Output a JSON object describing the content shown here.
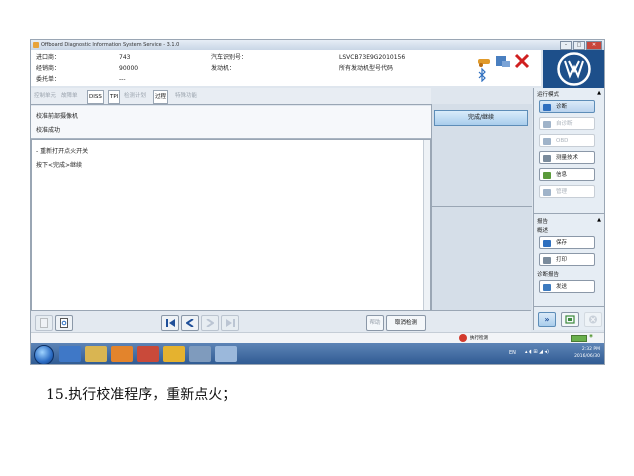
{
  "window": {
    "title": "Offboard Diagnostic Information System Service - 3.1.0"
  },
  "info": {
    "import_label": "进口商：",
    "import_value": "743",
    "dealer_label": "经销商：",
    "dealer_value": "90000",
    "client_label": "委托单：",
    "client_value": "---",
    "vin_label": "汽车识别号：",
    "vin_value": "LSVCB73E9G2010156",
    "engine_label": "发动机：",
    "engine_value": "所有发动机型号代码"
  },
  "tabs": [
    "控制单元",
    "故障单",
    "DISS",
    "TPI",
    "检测计划",
    "过程",
    "特殊功能"
  ],
  "header": {
    "title": "校准前部摄像机",
    "subtitle": "校准成功"
  },
  "content": {
    "lines": [
      "- 重新打开点火开关",
      "按下<完成>继续"
    ]
  },
  "buttons": {
    "continue": "完成/继续",
    "help": "帮助",
    "cancel": "取消检测"
  },
  "panel": {
    "mode_title": "运行模式",
    "mode_items": [
      {
        "label": "诊断",
        "state": "selected",
        "color": "#2e6fbf"
      },
      {
        "label": "自诊断",
        "state": "disabled",
        "color": "#9fb3c9"
      },
      {
        "label": "OBD",
        "state": "disabled",
        "color": "#9fb3c9"
      },
      {
        "label": "测量技术",
        "state": "normal",
        "color": "#7a8b9c"
      },
      {
        "label": "信息",
        "state": "normal",
        "color": "#5a9a3a"
      },
      {
        "label": "管理",
        "state": "disabled",
        "color": "#9fb3c9"
      }
    ],
    "report_title": "报告",
    "overview_title": "概述",
    "report_items": [
      {
        "label": "保存",
        "color": "#2e6fbf"
      },
      {
        "label": "打印",
        "color": "#7a8b9c"
      }
    ],
    "diag_title": "诊断报告",
    "diag_items": [
      {
        "label": "发送",
        "color": "#3c7abf"
      }
    ]
  },
  "status": {
    "text": "执行检测"
  },
  "taskbar": {
    "lang": "EN",
    "time": "2:32 PM",
    "date": "2016/06/30"
  },
  "caption": "15.执行校准程序，重新点火；"
}
